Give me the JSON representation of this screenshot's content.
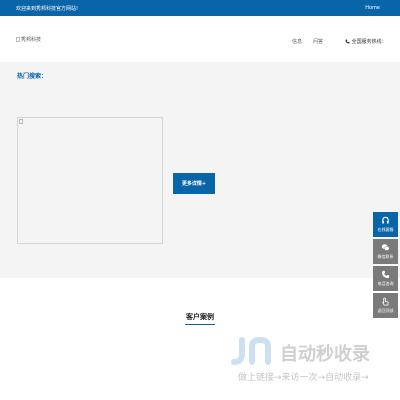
{
  "topbar": {
    "welcome": "欢迎来到秀邦科技官方网站!",
    "home": "Home"
  },
  "header": {
    "logo_alt": "秀邦科技",
    "nav": [
      "信息",
      "问答"
    ],
    "hotline": "全国服务热线："
  },
  "hot": {
    "title": "热门搜索："
  },
  "more_button": "更多详情+",
  "cases": {
    "title": "客户案例"
  },
  "watermark": {
    "brand": "自动秒收录",
    "slogan": "做上链接→来访一次→自动收录→"
  },
  "sidebar": {
    "items": [
      {
        "label": "在线客服",
        "icon": "headset-icon",
        "active": true
      },
      {
        "label": "微信联系",
        "icon": "wechat-icon",
        "active": false
      },
      {
        "label": "电话咨询",
        "icon": "phone-icon",
        "active": false
      },
      {
        "label": "返回顶部",
        "icon": "hand-up-icon",
        "active": false
      }
    ]
  },
  "colors": {
    "brand": "#0a65a8",
    "section_bg": "#f4f4f4",
    "sidebar_inactive": "#7a7a7a"
  }
}
